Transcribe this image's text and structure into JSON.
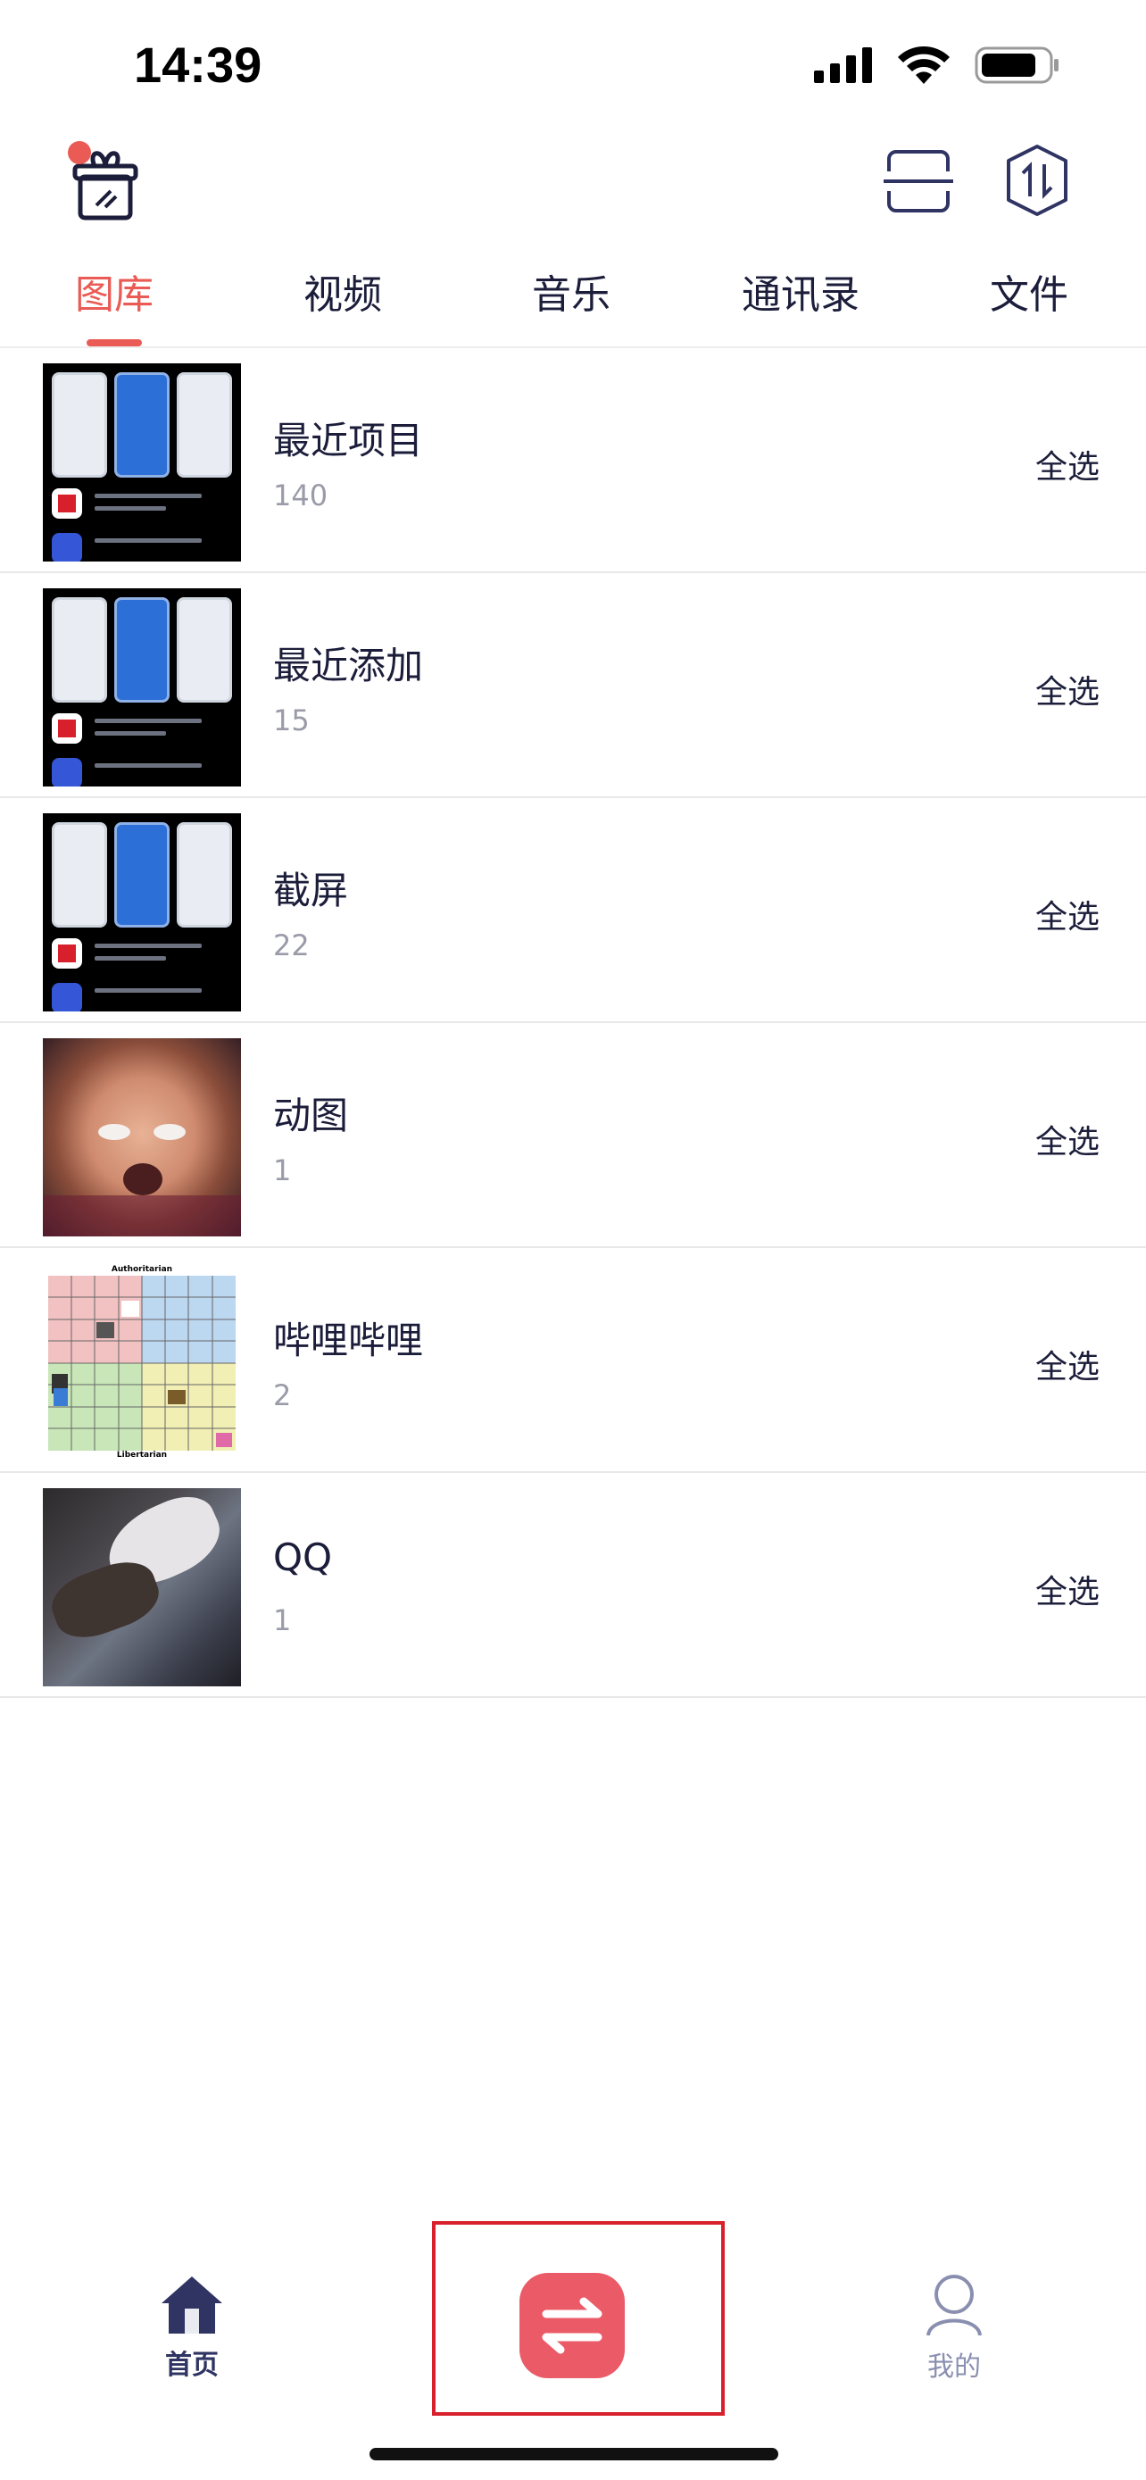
{
  "status_bar": {
    "time": "14:39"
  },
  "tabs": [
    {
      "label": "图库",
      "active": true
    },
    {
      "label": "视频",
      "active": false
    },
    {
      "label": "音乐",
      "active": false
    },
    {
      "label": "通讯录",
      "active": false
    },
    {
      "label": "文件",
      "active": false
    }
  ],
  "albums": [
    {
      "name": "最近项目",
      "count": "140",
      "select_label": "全选",
      "thumbnail": "app-screenshot"
    },
    {
      "name": "最近添加",
      "count": "15",
      "select_label": "全选",
      "thumbnail": "app-screenshot"
    },
    {
      "name": "截屏",
      "count": "22",
      "select_label": "全选",
      "thumbnail": "app-screenshot"
    },
    {
      "name": "动图",
      "count": "1",
      "select_label": "全选",
      "thumbnail": "surprised-face-photo"
    },
    {
      "name": "哔哩哔哩",
      "count": "2",
      "select_label": "全选",
      "thumbnail": "meme-grid"
    },
    {
      "name": "QQ",
      "count": "1",
      "select_label": "全选",
      "thumbnail": "hands-photo"
    }
  ],
  "bottom_nav": {
    "home_label": "首页",
    "mine_label": "我的"
  },
  "thumbnail_text": {
    "grid_top": "Authoritarian",
    "grid_bottom": "Libertarian"
  },
  "colors": {
    "accent": "#ea5b55",
    "transfer_button": "#ea5b67",
    "highlight_frame": "#d8202c",
    "primary_text": "#1b1d3a",
    "secondary_text": "#9a9ba8",
    "nav_active": "#2f3463",
    "nav_inactive": "#8a8fb0"
  },
  "icons": {
    "header_left": "gift-box-icon",
    "header_scan": "scan-icon",
    "header_transfer": "hexagon-swap-icon",
    "nav_home": "home-icon",
    "nav_transfer": "transfer-arrows-icon",
    "nav_mine": "person-icon"
  }
}
